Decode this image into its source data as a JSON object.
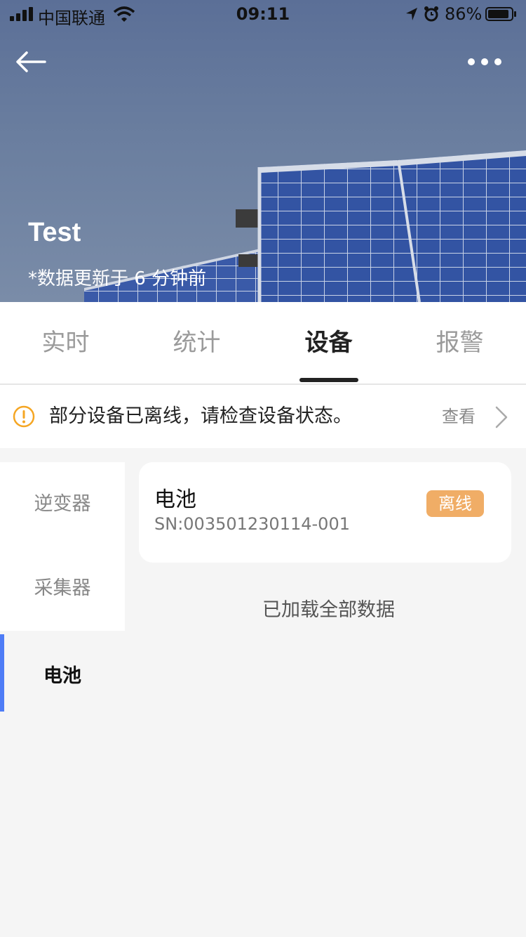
{
  "status_bar": {
    "carrier": "中国联通",
    "time": "09:11",
    "battery_percent": "86%"
  },
  "header": {
    "title": "Test",
    "updated": "*数据更新于 6 分钟前",
    "back_icon": "arrow-left-icon",
    "more_icon": "more-dots-icon"
  },
  "tabs": [
    {
      "label": "实时",
      "active": false
    },
    {
      "label": "统计",
      "active": false
    },
    {
      "label": "设备",
      "active": true
    },
    {
      "label": "报警",
      "active": false
    }
  ],
  "notice": {
    "text": "部分设备已离线，请检查设备状态。",
    "action": "查看",
    "icon": "warning-icon",
    "color": "#f5a623"
  },
  "sidebar": {
    "items": [
      {
        "label": "逆变器",
        "active": false
      },
      {
        "label": "采集器",
        "active": false
      },
      {
        "label": "电池",
        "active": true
      }
    ],
    "active_color": "#4e7cf6"
  },
  "devices": [
    {
      "name": "电池",
      "sn": "SN:003501230114-001",
      "status": "离线",
      "status_color": "#f0ad66"
    }
  ],
  "list_footer": "已加载全部数据"
}
